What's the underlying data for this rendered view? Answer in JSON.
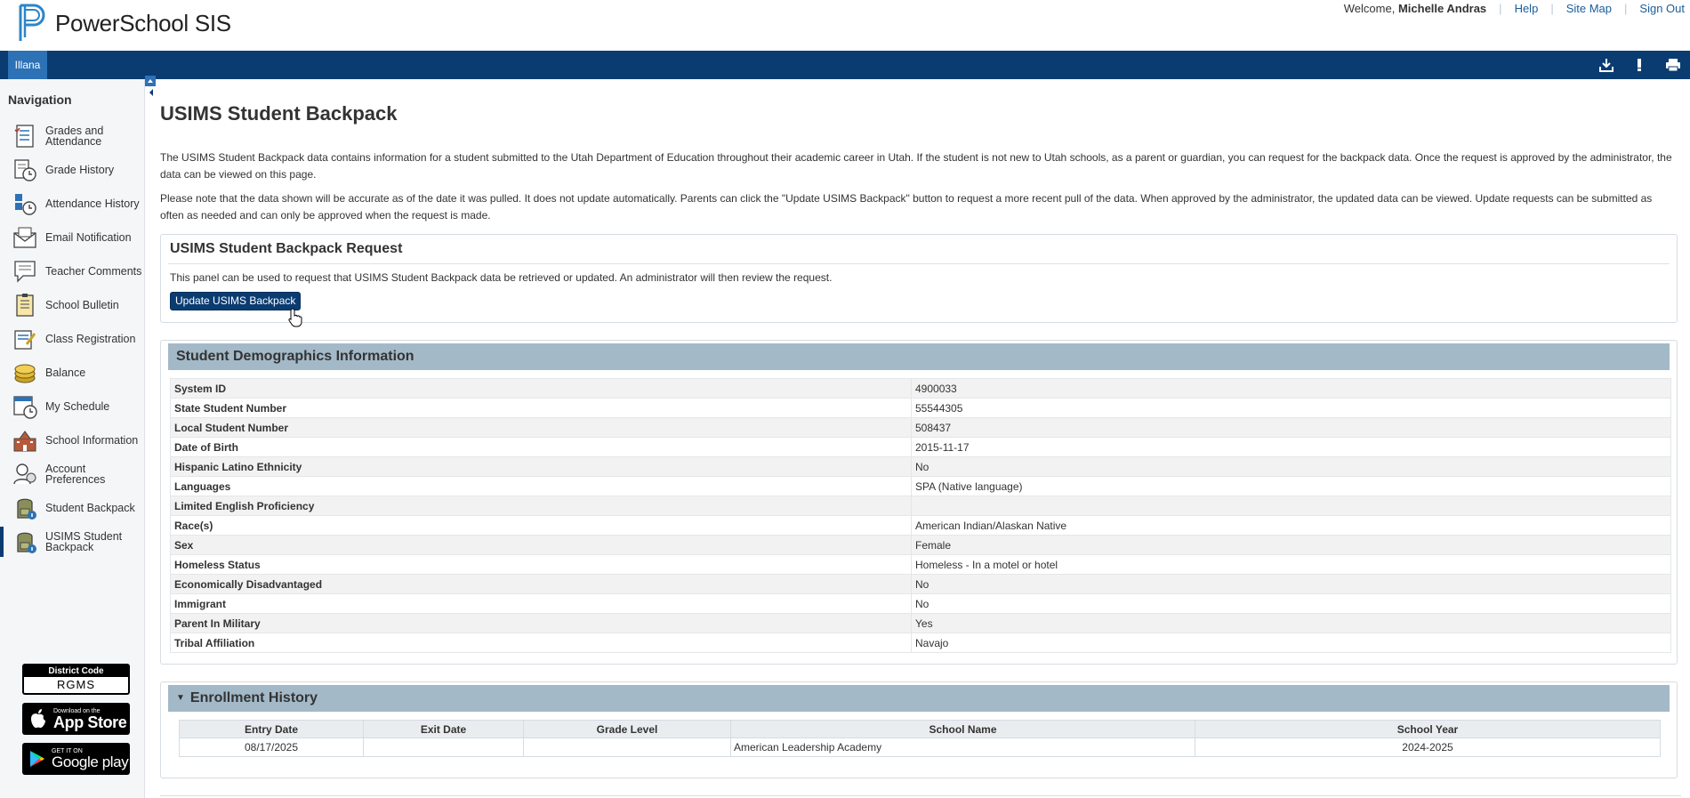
{
  "header": {
    "app_name": "PowerSchool SIS",
    "welcome_prefix": "Welcome,",
    "user_name": "Michelle Andras",
    "help": "Help",
    "site_map": "Site Map",
    "sign_out": "Sign Out"
  },
  "bluebar": {
    "student_tab": "Illana",
    "icons": [
      "download-icon",
      "alert-icon",
      "print-icon"
    ]
  },
  "sidebar": {
    "title": "Navigation",
    "items": [
      {
        "label": "Grades and Attendance",
        "icon": "grades-attendance-icon"
      },
      {
        "label": "Grade History",
        "icon": "grade-history-icon"
      },
      {
        "label": "Attendance History",
        "icon": "attendance-history-icon"
      },
      {
        "label": "Email Notification",
        "icon": "email-notification-icon"
      },
      {
        "label": "Teacher Comments",
        "icon": "teacher-comments-icon"
      },
      {
        "label": "School Bulletin",
        "icon": "school-bulletin-icon"
      },
      {
        "label": "Class Registration",
        "icon": "class-registration-icon"
      },
      {
        "label": "Balance",
        "icon": "balance-icon"
      },
      {
        "label": "My Schedule",
        "icon": "my-schedule-icon"
      },
      {
        "label": "School Information",
        "icon": "school-information-icon"
      },
      {
        "label": "Account Preferences",
        "icon": "account-preferences-icon"
      },
      {
        "label": "Student Backpack",
        "icon": "student-backpack-icon"
      },
      {
        "label": "USIMS Student Backpack",
        "icon": "usims-backpack-icon",
        "active": true
      }
    ],
    "district_code_label": "District Code",
    "district_code": "RGMS",
    "appstore_small": "Download on the",
    "appstore_big": "App Store",
    "googleplay_small": "GET IT ON",
    "googleplay_big": "Google play"
  },
  "main": {
    "title": "USIMS Student Backpack",
    "intro1": "The USIMS Student Backpack data contains information for a student submitted to the Utah Department of Education throughout their academic career in Utah. If the student is not new to Utah schools, as a parent or guardian, you can request for the backpack data. Once the request is approved by the administrator, the data can be viewed on this page.",
    "intro2": "Please note that the data shown will be accurate as of the date it was pulled. It does not update automatically. Parents can click the \"Update USIMS Backpack\" button to request a more recent pull of the data. When approved by the administrator, the updated data can be viewed. Update requests can be submitted as often as needed and can only be approved when the request is made.",
    "request": {
      "title": "USIMS Student Backpack Request",
      "description": "This panel can be used to request that USIMS Student Backpack data be retrieved or updated. An administrator will then review the request.",
      "button": "Update USIMS Backpack"
    },
    "demographics": {
      "title": "Student Demographics Information",
      "rows": [
        {
          "label": "System ID",
          "value": "4900033"
        },
        {
          "label": "State Student Number",
          "value": "55544305"
        },
        {
          "label": "Local Student Number",
          "value": "508437"
        },
        {
          "label": "Date of Birth",
          "value": "2015-11-17"
        },
        {
          "label": "Hispanic Latino Ethnicity",
          "value": "No"
        },
        {
          "label": "Languages",
          "value": "SPA (Native language)"
        },
        {
          "label": "Limited English Proficiency",
          "value": ""
        },
        {
          "label": "Race(s)",
          "value": "American Indian/Alaskan Native"
        },
        {
          "label": "Sex",
          "value": "Female"
        },
        {
          "label": "Homeless Status",
          "value": "Homeless - In a motel or hotel"
        },
        {
          "label": "Economically Disadvantaged",
          "value": "No"
        },
        {
          "label": "Immigrant",
          "value": "No"
        },
        {
          "label": "Parent In Military",
          "value": "Yes"
        },
        {
          "label": "Tribal Affiliation",
          "value": "Navajo"
        }
      ]
    },
    "enrollment": {
      "title": "Enrollment History",
      "columns": [
        "Entry Date",
        "Exit Date",
        "Grade Level",
        "School Name",
        "School Year"
      ],
      "rows": [
        [
          "08/17/2025",
          "",
          "",
          "American Leadership Academy",
          "2024-2025"
        ]
      ]
    }
  }
}
